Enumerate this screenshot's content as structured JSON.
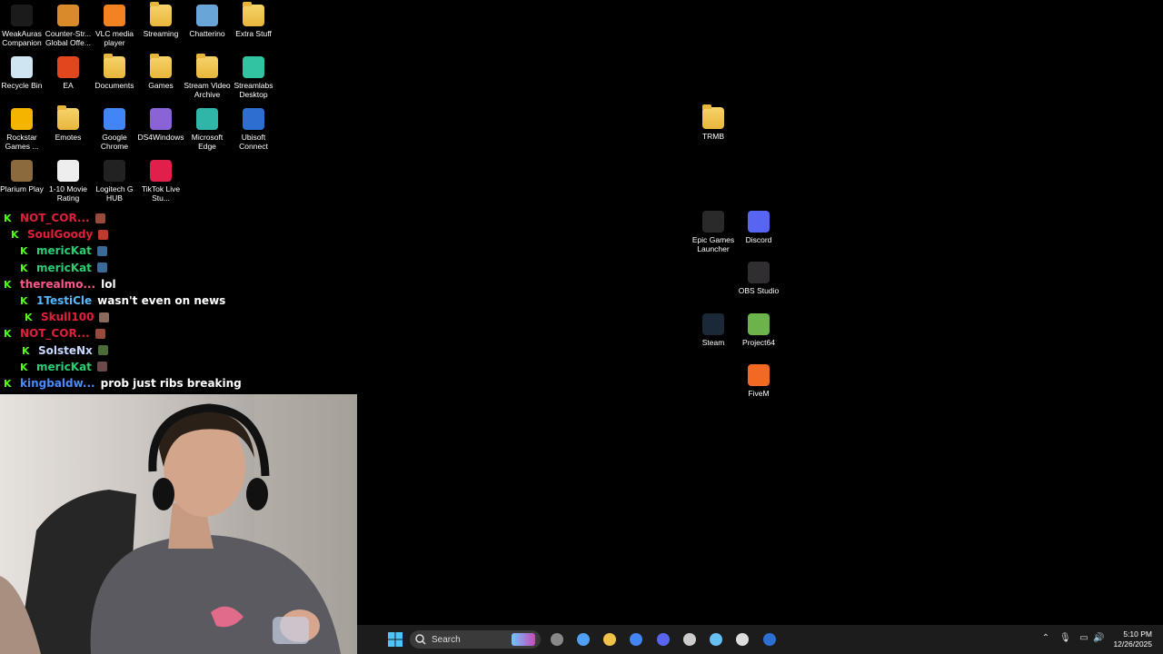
{
  "desktop_icons_left": [
    {
      "label": "WeakAuras Companion",
      "icon": "weakauras-icon",
      "color": "#1b1b1b"
    },
    {
      "label": "Counter-Str... Global Offe...",
      "icon": "csgo-icon",
      "color": "#d98a2b"
    },
    {
      "label": "VLC media player",
      "icon": "vlc-icon",
      "color": "#f58220"
    },
    {
      "label": "Streaming",
      "icon": "folder-icon",
      "color": "#f0c24a"
    },
    {
      "label": "Chatterino",
      "icon": "chatterino-icon",
      "color": "#6aa5d8"
    },
    {
      "label": "Extra Stuff",
      "icon": "folder-icon",
      "color": "#f0c24a"
    },
    {
      "label": "Recycle Bin",
      "icon": "recycle-bin-icon",
      "color": "#cfe6f2"
    },
    {
      "label": "EA",
      "icon": "ea-icon",
      "color": "#e2461f"
    },
    {
      "label": "Documents",
      "icon": "folder-icon",
      "color": "#f0c24a"
    },
    {
      "label": "Games",
      "icon": "folder-icon",
      "color": "#f0c24a"
    },
    {
      "label": "Stream Video Archive",
      "icon": "folder-icon",
      "color": "#f0c24a"
    },
    {
      "label": "Streamlabs Desktop",
      "icon": "streamlabs-icon",
      "color": "#31c3a2"
    },
    {
      "label": "Rockstar Games ...",
      "icon": "rockstar-icon",
      "color": "#f4b400"
    },
    {
      "label": "Emotes",
      "icon": "folder-icon",
      "color": "#f0c24a"
    },
    {
      "label": "Google Chrome",
      "icon": "chrome-icon",
      "color": "#4285f4"
    },
    {
      "label": "DS4Windows",
      "icon": "controller-icon",
      "color": "#8a64d6"
    },
    {
      "label": "Microsoft Edge",
      "icon": "edge-icon",
      "color": "#2fb6a8"
    },
    {
      "label": "Ubisoft Connect",
      "icon": "ubisoft-icon",
      "color": "#2d6fd1"
    },
    {
      "label": "Plarium Play",
      "icon": "plarium-icon",
      "color": "#8b6a3e"
    },
    {
      "label": "1-10 Movie Rating",
      "icon": "document-icon",
      "color": "#eeeeee"
    },
    {
      "label": "Logitech G HUB",
      "icon": "logitech-icon",
      "color": "#222222"
    },
    {
      "label": "TikTok Live Stu...",
      "icon": "tiktok-icon",
      "color": "#e01f4a"
    }
  ],
  "desktop_icons_right": [
    {
      "label": "TRMB",
      "icon": "folder-icon",
      "color": "#f0c24a"
    },
    {
      "label": "Epic Games Launcher",
      "icon": "epic-icon",
      "color": "#2a2a2a"
    },
    {
      "label": "Discord",
      "icon": "discord-icon",
      "color": "#5865f2"
    },
    {
      "label": "OBS Studio",
      "icon": "obs-icon",
      "color": "#302e31"
    },
    {
      "label": "Steam",
      "icon": "steam-icon",
      "color": "#1b2838"
    },
    {
      "label": "Project64",
      "icon": "project64-icon",
      "color": "#6bb34a"
    },
    {
      "label": "FiveM",
      "icon": "fivem-icon",
      "color": "#f26a21"
    }
  ],
  "chat": [
    {
      "user": "NOT_COR...",
      "color": "#e0203a",
      "message": "",
      "emote": "#9a4a3a"
    },
    {
      "user": "SoulGoody",
      "color": "#e0203a",
      "message": "",
      "emote": "#c0392b"
    },
    {
      "user": "mericKat",
      "color": "#2ecc71",
      "message": "",
      "emote": "#3a6a9a"
    },
    {
      "user": "mericKat",
      "color": "#2ecc71",
      "message": "",
      "emote": "#3a6a9a"
    },
    {
      "user": "therealmo...",
      "color": "#ff5a8a",
      "message": "lol",
      "emote": ""
    },
    {
      "user": "1TestiCle",
      "color": "#58b7ff",
      "message": "wasn't even on news",
      "emote": ""
    },
    {
      "user": "Skull100",
      "color": "#e0203a",
      "message": "",
      "emote": "#8a6a5a"
    },
    {
      "user": "NOT_COR...",
      "color": "#e0203a",
      "message": "",
      "emote": "#9a4a3a"
    },
    {
      "user": "SolsteNx",
      "color": "#c8d8ff",
      "message": "",
      "emote": "#4a6a3a"
    },
    {
      "user": "mericKat",
      "color": "#2ecc71",
      "message": "",
      "emote": "#6a4a4a"
    },
    {
      "user": "kingbaldw...",
      "color": "#4a8aff",
      "message": "prob just ribs breaking",
      "emote": ""
    }
  ],
  "taskbar": {
    "search_placeholder": "Search",
    "time": "5:10 PM",
    "date": "12/26/2025",
    "apps": [
      {
        "icon": "task-view-icon",
        "color": "#888888"
      },
      {
        "icon": "copilot-icon",
        "color": "#4f9ff5"
      },
      {
        "icon": "file-explorer-icon",
        "color": "#f0c24a"
      },
      {
        "icon": "chrome-icon",
        "color": "#4285f4"
      },
      {
        "icon": "discord-icon",
        "color": "#5865f2"
      },
      {
        "icon": "obs-icon",
        "color": "#cccccc"
      },
      {
        "icon": "steam-icon",
        "color": "#66c0f4"
      },
      {
        "icon": "epic-icon",
        "color": "#dddddd"
      },
      {
        "icon": "edge-icon",
        "color": "#2d6fd1"
      }
    ]
  }
}
